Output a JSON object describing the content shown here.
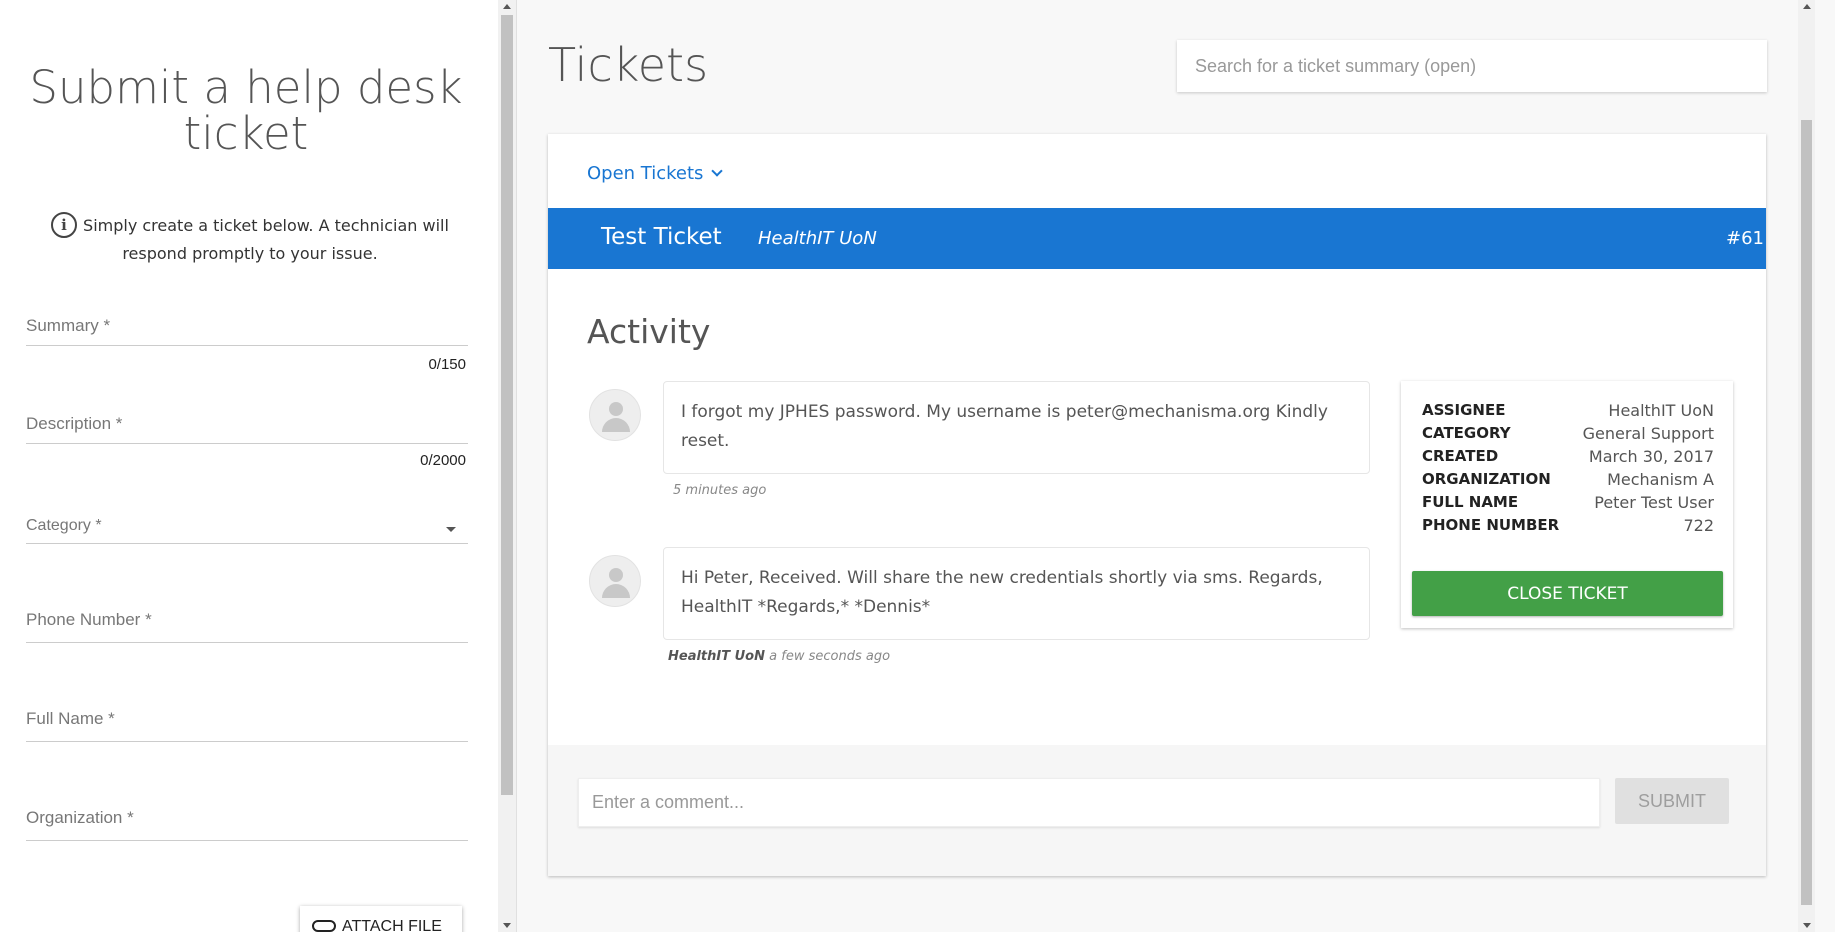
{
  "form": {
    "title": "Submit a help desk ticket",
    "info_text": "Simply create a ticket below. A technician will respond promptly to your issue.",
    "info_icon": "info-icon",
    "summary_label": "Summary *",
    "summary_counter": "0/150",
    "description_label": "Description *",
    "description_counter": "0/2000",
    "category_label": "Category *",
    "phone_label": "Phone Number *",
    "fullname_label": "Full Name *",
    "organization_label": "Organization *",
    "attach_label": "ATTACH FILE"
  },
  "header": {
    "title": "Tickets",
    "search_placeholder": "Search for a ticket summary (open)"
  },
  "ticket_list": {
    "filter_label": "Open Tickets"
  },
  "ticket": {
    "title": "Test Ticket",
    "organization": "HealthIT UoN",
    "number": "#61",
    "color": "#1976d2"
  },
  "activity": {
    "title": "Activity",
    "messages": [
      {
        "text": "I forgot my JPHES password. My username is peter@mechanisma.org Kindly reset.",
        "author": "",
        "time": "5 minutes ago"
      },
      {
        "text": "Hi Peter, Received. Will share the new credentials shortly via sms. Regards, HealthIT *Regards,* *Dennis*",
        "author": "HealthIT UoN",
        "time": "a few seconds ago"
      }
    ]
  },
  "details": {
    "rows": [
      {
        "key": "ASSIGNEE",
        "value": "HealthIT UoN"
      },
      {
        "key": "CATEGORY",
        "value": "General Support"
      },
      {
        "key": "CREATED",
        "value": "March 30, 2017"
      },
      {
        "key": "ORGANIZATION",
        "value": "Mechanism A"
      },
      {
        "key": "FULL NAME",
        "value": "Peter Test User"
      },
      {
        "key": "PHONE NUMBER",
        "value": "722"
      }
    ],
    "close_label": "CLOSE TICKET",
    "close_color": "#43a047"
  },
  "comment": {
    "placeholder": "Enter a comment...",
    "submit_label": "SUBMIT"
  }
}
